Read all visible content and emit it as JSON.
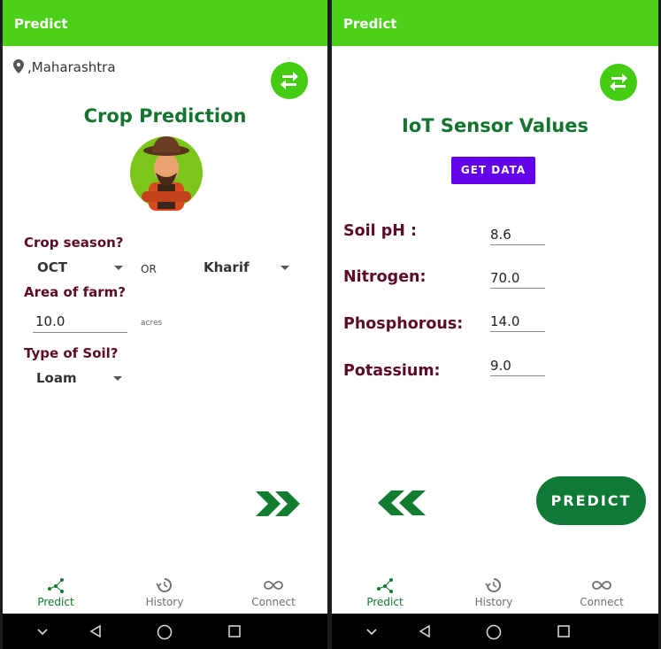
{
  "left": {
    "appbar_title": "Predict",
    "location": ",Maharashtra",
    "heading": "Crop Prediction",
    "crop_season_label": "Crop season?",
    "month_value": "OCT",
    "or_text": "OR",
    "season_value": "Kharif",
    "area_label": "Area of farm?",
    "area_value": "10.0",
    "area_unit": "acres",
    "soil_label": "Type of Soil?",
    "soil_value": "Loam"
  },
  "right": {
    "appbar_title": "Predict",
    "heading": "IoT Sensor Values",
    "get_data_label": "GET DATA",
    "sensors": [
      {
        "label": "Soil pH :",
        "value": "8.6"
      },
      {
        "label": "Nitrogen:",
        "value": "70.0"
      },
      {
        "label": "Phosphorous:",
        "value": "14.0"
      },
      {
        "label": "Potassium:",
        "value": "9.0"
      }
    ],
    "predict_label": "PREDICT"
  },
  "nav": {
    "predict": "Predict",
    "history": "History",
    "connect": "Connect"
  },
  "colors": {
    "appbar": "#4cd01a",
    "heading_green": "#13742f",
    "label_maroon": "#5c0a2a",
    "get_data_purple": "#6200ea",
    "predict_button": "#0f7a36"
  }
}
